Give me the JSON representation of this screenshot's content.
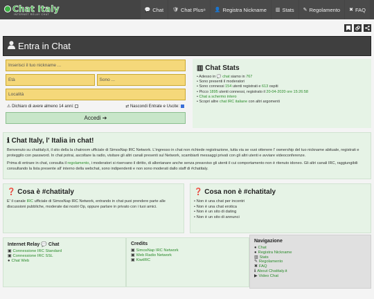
{
  "brand": {
    "name": "Chat Italy",
    "tagline": "INTERNET RELAY CHAT"
  },
  "navbar": {
    "items": [
      {
        "label": "Chat",
        "icon": "💬"
      },
      {
        "label": "Chat Plus",
        "sup": "®",
        "icon": "🛡"
      },
      {
        "label": "Registra Nickname",
        "icon": "👤"
      },
      {
        "label": "Stats",
        "icon": "▥"
      },
      {
        "label": "Regolamento",
        "icon": "✎"
      },
      {
        "label": "FAQ",
        "icon": "✖"
      }
    ]
  },
  "util_icons": [
    "bookmark-icon",
    "link-icon",
    "share-icon"
  ],
  "title": {
    "text": "Entra in Chat"
  },
  "login": {
    "nickname_placeholder": "Inserisci il tuo nickname ...",
    "age_placeholder": "Età",
    "sex_placeholder": "Sono ...",
    "location_placeholder": "Località",
    "age_check_label": "Dichiaro di avere almeno 14 anni:",
    "hide_label": "Nascondi Entrate e Uscite:",
    "submit_label": "Accedi"
  },
  "stats": {
    "title": "Chat Stats",
    "line1_a": "Adesso in",
    "line1_b": "chat",
    "line1_c": "siamo in",
    "line1_n": "767",
    "line2": "Sono presenti il moderatori",
    "line3_a": "Sono connessi",
    "line3_n1": "154",
    "line3_b": "utenti registrati e",
    "line3_n2": "613",
    "line3_c": "ospiti",
    "line4_a": "Picco",
    "line4_n": "1895",
    "line4_b": "utenti connessi, registrato il",
    "line4_d": "20-04-2020 ore 15:26:58",
    "line5": "Chat a schermo intero",
    "line6_a": "Scopri altre",
    "line6_b": "chat IRC italiane",
    "line6_c": "con altri argomenti"
  },
  "intro": {
    "title": "Chat Italy, l' Italia in chat!",
    "p1": "Benvenuto su chatitaly.it, il sito della la chatroom ufficiale di SimosNap IRC Network. L'ingresso in chat non richiede registrazione, tutta via se vuoi ottenere l' ownership del tuo nickname abituale, registrati e proteggilo con password. In chat potrai, ascoltare la radio, visitare gli altri canali presenti sul Network, scambiarti messaggi privati con gli altri utenti e avviare videoconferenze.",
    "p2_a": "Prima di entrare in chat, consulta il",
    "p2_link": "regolamento",
    "p2_b": ", i moderatori si riservano il diritto, di allontanare anche senza preavviso gli utenti il cui comportamento non è ritenuto idoneo. Gli altri canali IRC, raggiungibili consultando la lista presente all' interno della webchat, sono indipendenti e non sono moderati dallo staff di #chatitaly."
  },
  "what": {
    "title": "Cosa è #chatitaly",
    "p_a": "E' il canale",
    "p_link": "IRC",
    "p_b": "ufficiale di SimosNap IRC Network, entrando in chat puoi prendere parte alle discussioni pubbliche, moderate dai nostri Op, oppure parlare in privato con i tuoi amici."
  },
  "whatnot": {
    "title": "Cosa non è #chatitaly",
    "items": [
      "Non è una chat per incontri",
      "Non è una chat erotica",
      "Non è un sito di dating",
      "Non è un sito di annunci"
    ]
  },
  "footer": {
    "irc": {
      "title_a": "Internet Relay",
      "title_b": "Chat",
      "items": [
        "Connessione IRC Standard",
        "Connessione IRC SSL",
        "Chat Web"
      ]
    },
    "credits": {
      "title": "Credits",
      "items": [
        "SimosNap IRC Network",
        "Web Radio Network",
        "KiwiIRC"
      ]
    },
    "nav": {
      "title": "Navigazione",
      "items": [
        "Chat",
        "Registra Nickname",
        "Stats",
        "Regolamento",
        "FAQ",
        "About Chatitaly.it",
        "Video Chat"
      ]
    }
  },
  "colors": {
    "navbar": "#444444",
    "accent_green": "#2a8a2a",
    "input_yellow": "#f5d87a",
    "panel_green": "#e6f3e6"
  }
}
